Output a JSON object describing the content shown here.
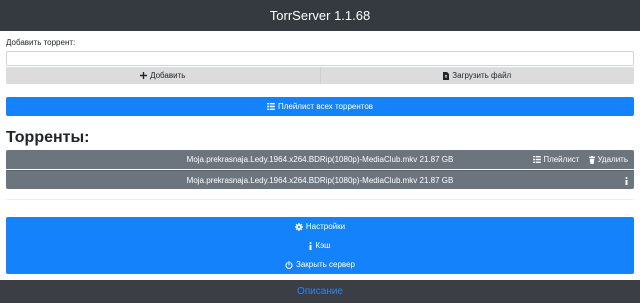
{
  "header": {
    "title": "TorrServer 1.1.68"
  },
  "add_torrent": {
    "label": "Добавить торрент:",
    "input_value": "",
    "add_button": "Добавить",
    "upload_button": "Загрузить файл"
  },
  "playlist_all_button": "Плейлист всех торрентов",
  "torrents_section": {
    "title": "Торренты:",
    "items": [
      {
        "title": "Moja.prekrasnaja.Ledy.1964.x264.BDRip(1080p)-MediaClub.mkv 21.87 GB",
        "playlist_label": "Плейлист",
        "delete_label": "Удалить"
      }
    ],
    "files": [
      {
        "title": "Moja.prekrasnaja.Ledy.1964.x264.BDRip(1080p)-MediaClub.mkv 21.87 GB"
      }
    ]
  },
  "settings_panel": {
    "settings_button": "Настройки",
    "cache_button": "Кэш",
    "shutdown_button": "Закрыть сервер"
  },
  "footer": {
    "link": "Описание"
  },
  "colors": {
    "primary": "#1483fb",
    "secondary": "#6c757d",
    "header_bg": "#343a40",
    "link": "#1e88ff"
  },
  "icons": [
    "plus-icon",
    "file-upload-icon",
    "list-icon",
    "trash-icon",
    "info-icon",
    "gear-icon",
    "power-icon"
  ]
}
